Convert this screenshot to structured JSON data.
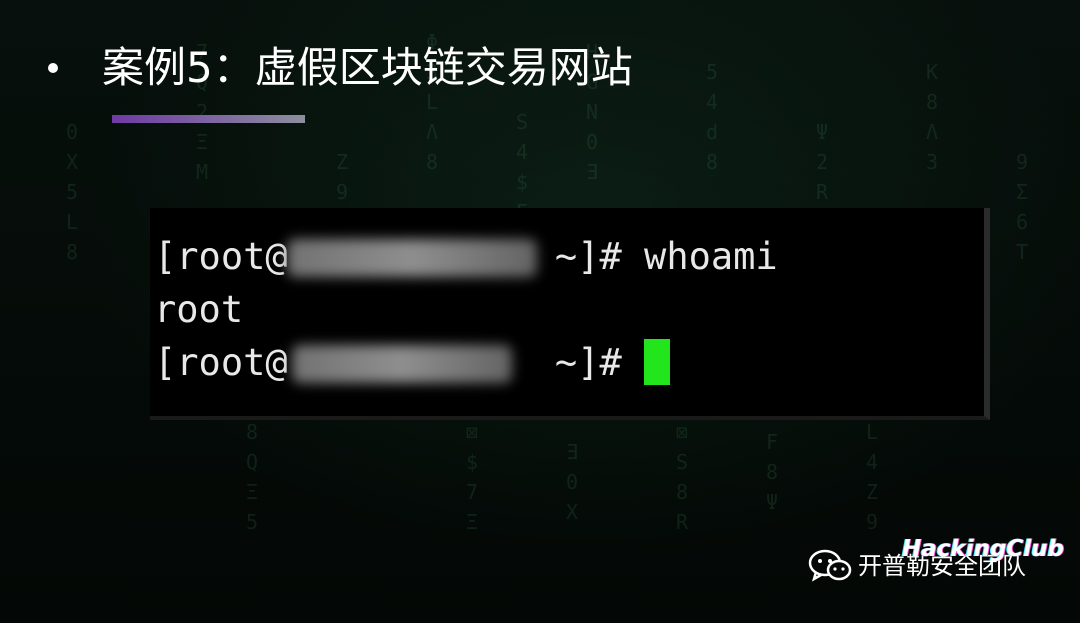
{
  "slide": {
    "bullet_title": "案例5：虚假区块链交易网站"
  },
  "terminal": {
    "line1_prompt_start": "[root@",
    "line1_prompt_end": " ~]# ",
    "line1_command": "whoami",
    "line2_output": "root",
    "line3_prompt_start": "[root@",
    "line3_prompt_end": " ~]# ",
    "cursor_color": "#22e51b"
  },
  "watermark": {
    "account_name": "开普勒安全团队",
    "logo_text": "HackingClub",
    "icon": "wechat-icon"
  },
  "colors": {
    "background": "#050907",
    "title_text": "#ffffff",
    "underline_start": "#6f3aa5",
    "underline_end": "#8c8f9e"
  }
}
